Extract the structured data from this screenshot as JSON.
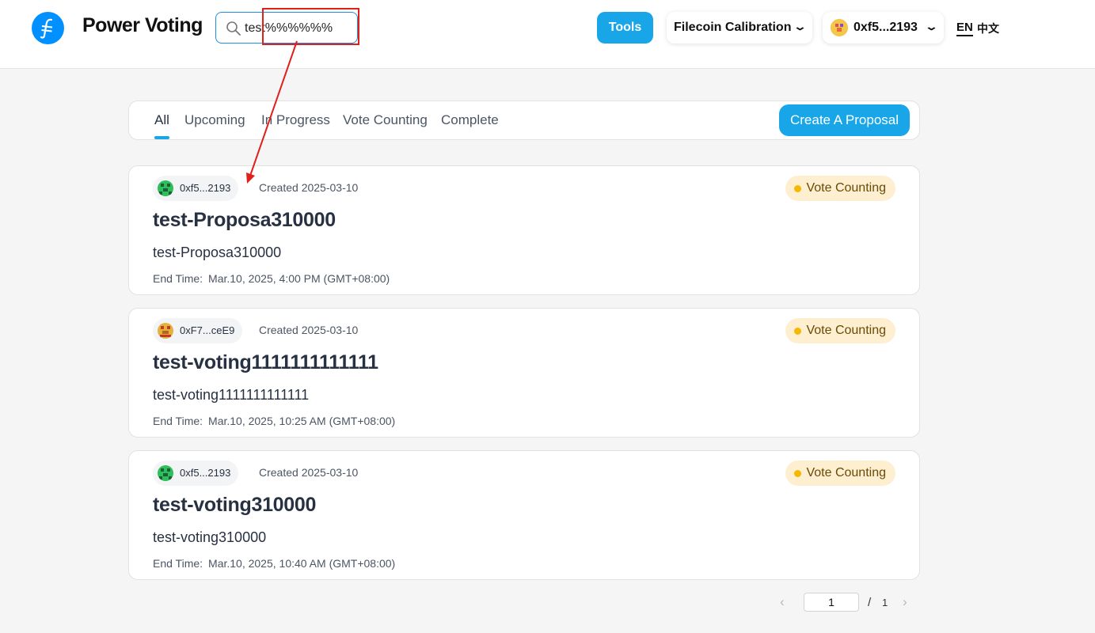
{
  "header": {
    "app_title": "Power Voting",
    "logo_icon": "filecoin-icon",
    "search": {
      "value": "test%%%%%%",
      "icon": "search-icon"
    },
    "tools_label": "Tools",
    "network_label": "Filecoin Calibration",
    "wallet_label": "0xf5...2193",
    "lang_en": "EN",
    "lang_zh": "中文"
  },
  "tabs": {
    "items": [
      "All",
      "Upcoming",
      "In Progress",
      "Vote Counting",
      "Complete"
    ],
    "active": "All",
    "create_label": "Create A Proposal"
  },
  "proposals": [
    {
      "author": "0xf5...2193",
      "created": "Created 2025-03-10",
      "status": "Vote Counting",
      "title": "test-Proposa310000",
      "description": "test-Proposa310000",
      "end_label": "End Time:",
      "end_time": "Mar.10, 2025, 4:00 PM (GMT+08:00)"
    },
    {
      "author": "0xF7...ceE9",
      "created": "Created 2025-03-10",
      "status": "Vote Counting",
      "title": "test-voting1111111111111",
      "description": "test-voting1111111111111",
      "end_label": "End Time:",
      "end_time": "Mar.10, 2025, 10:25 AM (GMT+08:00)"
    },
    {
      "author": "0xf5...2193",
      "created": "Created 2025-03-10",
      "status": "Vote Counting",
      "title": "test-voting310000",
      "description": "test-voting310000",
      "end_label": "End Time:",
      "end_time": "Mar.10, 2025, 10:40 AM (GMT+08:00)"
    }
  ],
  "pagination": {
    "current": "1",
    "separator": "/",
    "total": "1"
  },
  "colors": {
    "accent": "#18a6e8",
    "status_bg": "#fdefcf",
    "status_dot": "#f5b800",
    "annotation": "#e0201b"
  }
}
